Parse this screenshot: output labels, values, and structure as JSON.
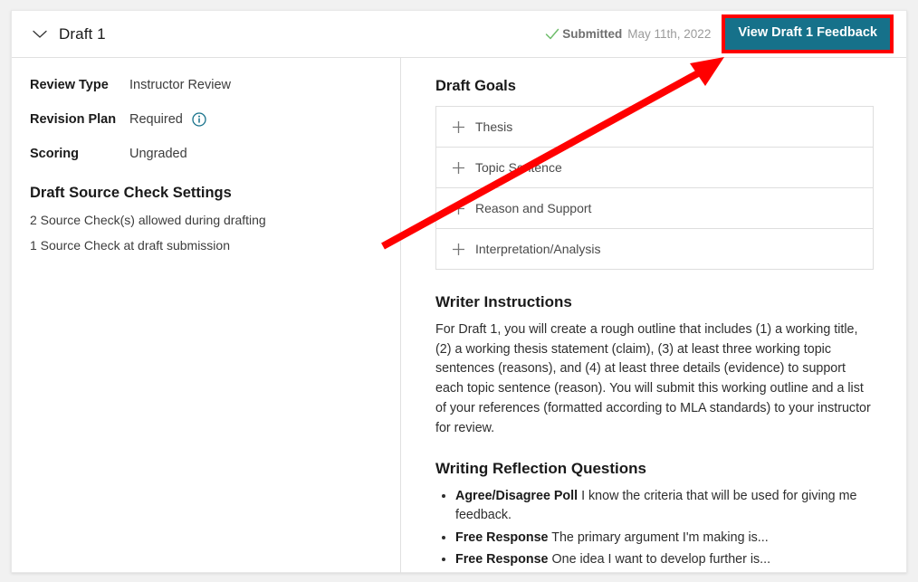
{
  "header": {
    "title": "Draft 1",
    "chevron_icon": "chevron-down-icon",
    "status": {
      "check_icon": "green-check-icon",
      "label": "Submitted",
      "date": "May 11th, 2022"
    },
    "feedback_button": "View Draft 1 Feedback",
    "annotation_color": "#ff0000",
    "button_color": "#16718a"
  },
  "left_panel": {
    "meta": [
      {
        "label": "Review Type",
        "value": "Instructor Review",
        "has_info_icon": false
      },
      {
        "label": "Revision Plan",
        "value": "Required",
        "has_info_icon": true
      },
      {
        "label": "Scoring",
        "value": "Ungraded",
        "has_info_icon": false
      }
    ],
    "source_check": {
      "heading": "Draft Source Check Settings",
      "lines": [
        "2 Source Check(s) allowed during drafting",
        "1 Source Check at draft submission"
      ]
    }
  },
  "right_panel": {
    "draft_goals": {
      "heading": "Draft Goals",
      "items": [
        {
          "label": "Thesis",
          "icon": "plus-icon"
        },
        {
          "label": "Topic Sentence",
          "icon": "plus-icon"
        },
        {
          "label": "Reason and Support",
          "icon": "plus-icon"
        },
        {
          "label": "Interpretation/Analysis",
          "icon": "plus-icon"
        }
      ]
    },
    "writer_instructions": {
      "heading": "Writer Instructions",
      "body": "For Draft 1, you will create a rough outline that includes (1) a working title, (2) a working thesis statement (claim), (3) at least three working topic sentences (reasons), and (4) at least three details (evidence) to support each topic sentence (reason). You will submit this working outline and a list of your references (formatted according to MLA standards) to your instructor for review."
    },
    "reflection": {
      "heading": "Writing Reflection Questions",
      "questions": [
        {
          "type": "Agree/Disagree Poll",
          "text": "I know the criteria that will be used for giving me feedback."
        },
        {
          "type": "Free Response",
          "text": "The primary argument I'm making is..."
        },
        {
          "type": "Free Response",
          "text": "One idea I want to develop further is..."
        }
      ]
    }
  }
}
